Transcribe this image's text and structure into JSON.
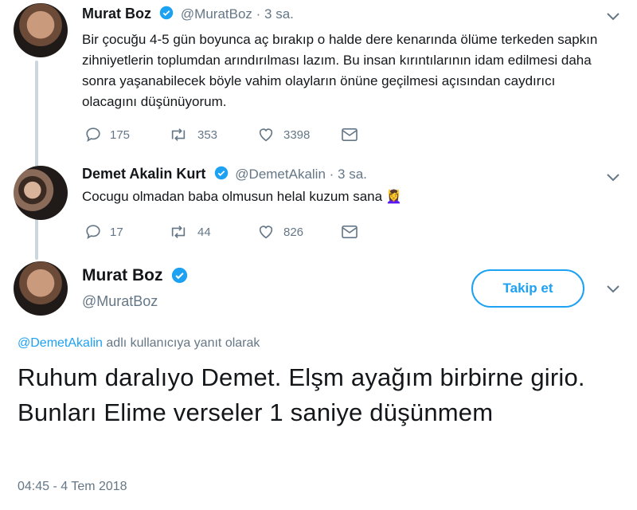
{
  "tweet1": {
    "name": "Murat Boz",
    "handle": "@MuratBoz",
    "time": " · 3 sa.",
    "text": "Bir çocuğu 4-5 gün boyunca aç bırakıp o halde dere kenarında ölüme terkeden sapkın zihniyetlerin toplumdan arındırılması lazım. Bu insan kırıntılarının idam edilmesi daha sonra yaşanabilecek böyle vahim olayların önüne geçilmesi açısından caydırıcı olacagını düşünüyorum.",
    "replies": "175",
    "retweets": "353",
    "likes": "3398"
  },
  "tweet2": {
    "name": "Demet Akalin Kurt",
    "handle": "@DemetAkalin",
    "time": " · 3 sa.",
    "text": "Cocugu olmadan baba olmusun helal kuzum sana",
    "emoji": "💆‍♀️",
    "replies": "17",
    "retweets": "44",
    "likes": "826"
  },
  "main": {
    "name": "Murat Boz",
    "handle": "@MuratBoz",
    "follow_label": "Takip et",
    "reply_to_handle": "@DemetAkalin",
    "reply_to_suffix": " adlı kullanıcıya yanıt olarak",
    "text": "Ruhum daralıyo Demet. Elşm ayağım birbirne girio. Bunları Elime verseler 1 saniye düşünmem",
    "timestamp": "04:45 - 4 Tem 2018"
  },
  "colors": {
    "accent": "#1da1f2",
    "secondary_text": "#657786",
    "thread_line": "#ccd6dd"
  }
}
